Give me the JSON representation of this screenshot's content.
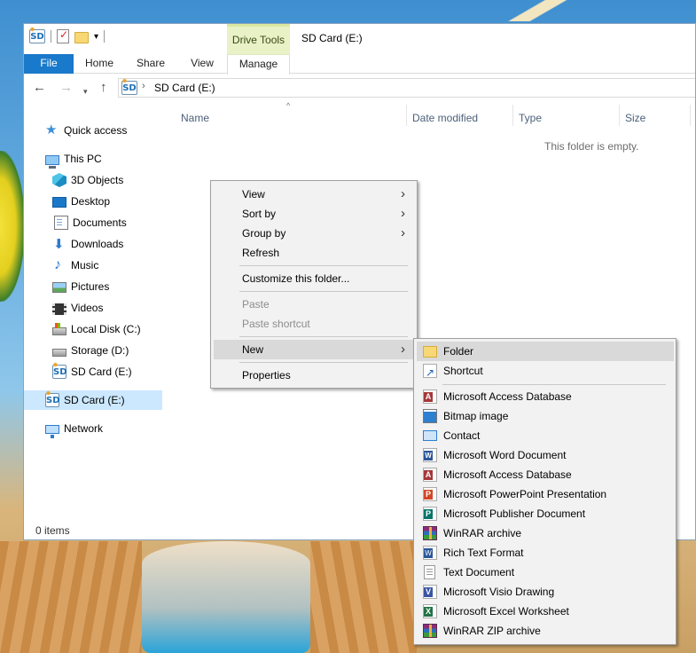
{
  "window": {
    "title": "SD Card (E:)",
    "contextual_tab_group": "Drive Tools"
  },
  "ribbon": {
    "tabs": [
      "File",
      "Home",
      "Share",
      "View",
      "Manage"
    ]
  },
  "address": {
    "path": "SD Card (E:)"
  },
  "navigation": {
    "items": [
      {
        "label": "Quick access",
        "icon": "star-icon"
      },
      {
        "label": "This PC",
        "icon": "computer-icon"
      },
      {
        "label": "3D Objects",
        "icon": "3d-objects-icon"
      },
      {
        "label": "Desktop",
        "icon": "desktop-icon"
      },
      {
        "label": "Documents",
        "icon": "documents-icon"
      },
      {
        "label": "Downloads",
        "icon": "downloads-icon"
      },
      {
        "label": "Music",
        "icon": "music-icon"
      },
      {
        "label": "Pictures",
        "icon": "pictures-icon"
      },
      {
        "label": "Videos",
        "icon": "videos-icon"
      },
      {
        "label": "Local Disk (C:)",
        "icon": "local-disk-icon"
      },
      {
        "label": "Storage (D:)",
        "icon": "drive-icon"
      },
      {
        "label": "SD Card (E:)",
        "icon": "sd-card-icon"
      },
      {
        "label": "SD Card (E:)",
        "icon": "sd-card-icon",
        "selected": true
      },
      {
        "label": "Network",
        "icon": "network-icon"
      }
    ]
  },
  "file_list": {
    "columns": [
      "Name",
      "Date modified",
      "Type",
      "Size"
    ],
    "empty_message": "This folder is empty."
  },
  "status": {
    "item_count": "0 items"
  },
  "context_menu": {
    "items": [
      {
        "label": "View",
        "submenu": true
      },
      {
        "label": "Sort by",
        "submenu": true
      },
      {
        "label": "Group by",
        "submenu": true
      },
      {
        "label": "Refresh"
      },
      {
        "label": "Customize this folder..."
      },
      {
        "label": "Paste",
        "disabled": true
      },
      {
        "label": "Paste shortcut",
        "disabled": true
      },
      {
        "label": "New",
        "submenu": true,
        "highlighted": true
      },
      {
        "label": "Properties"
      }
    ]
  },
  "new_submenu": {
    "items": [
      {
        "label": "Folder",
        "icon": "folder-icon",
        "highlighted": true
      },
      {
        "label": "Shortcut",
        "icon": "shortcut-icon"
      },
      {
        "label": "Microsoft Access Database",
        "icon": "access-icon"
      },
      {
        "label": "Bitmap image",
        "icon": "bitmap-icon"
      },
      {
        "label": "Contact",
        "icon": "contact-icon"
      },
      {
        "label": "Microsoft Word Document",
        "icon": "word-icon"
      },
      {
        "label": "Microsoft Access Database",
        "icon": "access-icon"
      },
      {
        "label": "Microsoft PowerPoint Presentation",
        "icon": "powerpoint-icon"
      },
      {
        "label": "Microsoft Publisher Document",
        "icon": "publisher-icon"
      },
      {
        "label": "WinRAR archive",
        "icon": "winrar-icon"
      },
      {
        "label": "Rich Text Format",
        "icon": "rtf-icon"
      },
      {
        "label": "Text Document",
        "icon": "text-document-icon"
      },
      {
        "label": "Microsoft Visio Drawing",
        "icon": "visio-icon"
      },
      {
        "label": "Microsoft Excel Worksheet",
        "icon": "excel-icon"
      },
      {
        "label": "WinRAR ZIP archive",
        "icon": "winrar-zip-icon"
      }
    ]
  },
  "colors": {
    "file_tab": "#1979ca",
    "selection": "#cce8ff",
    "menu_highlight": "#d9d9d9",
    "contextual_tab": "#e9f1c7"
  }
}
